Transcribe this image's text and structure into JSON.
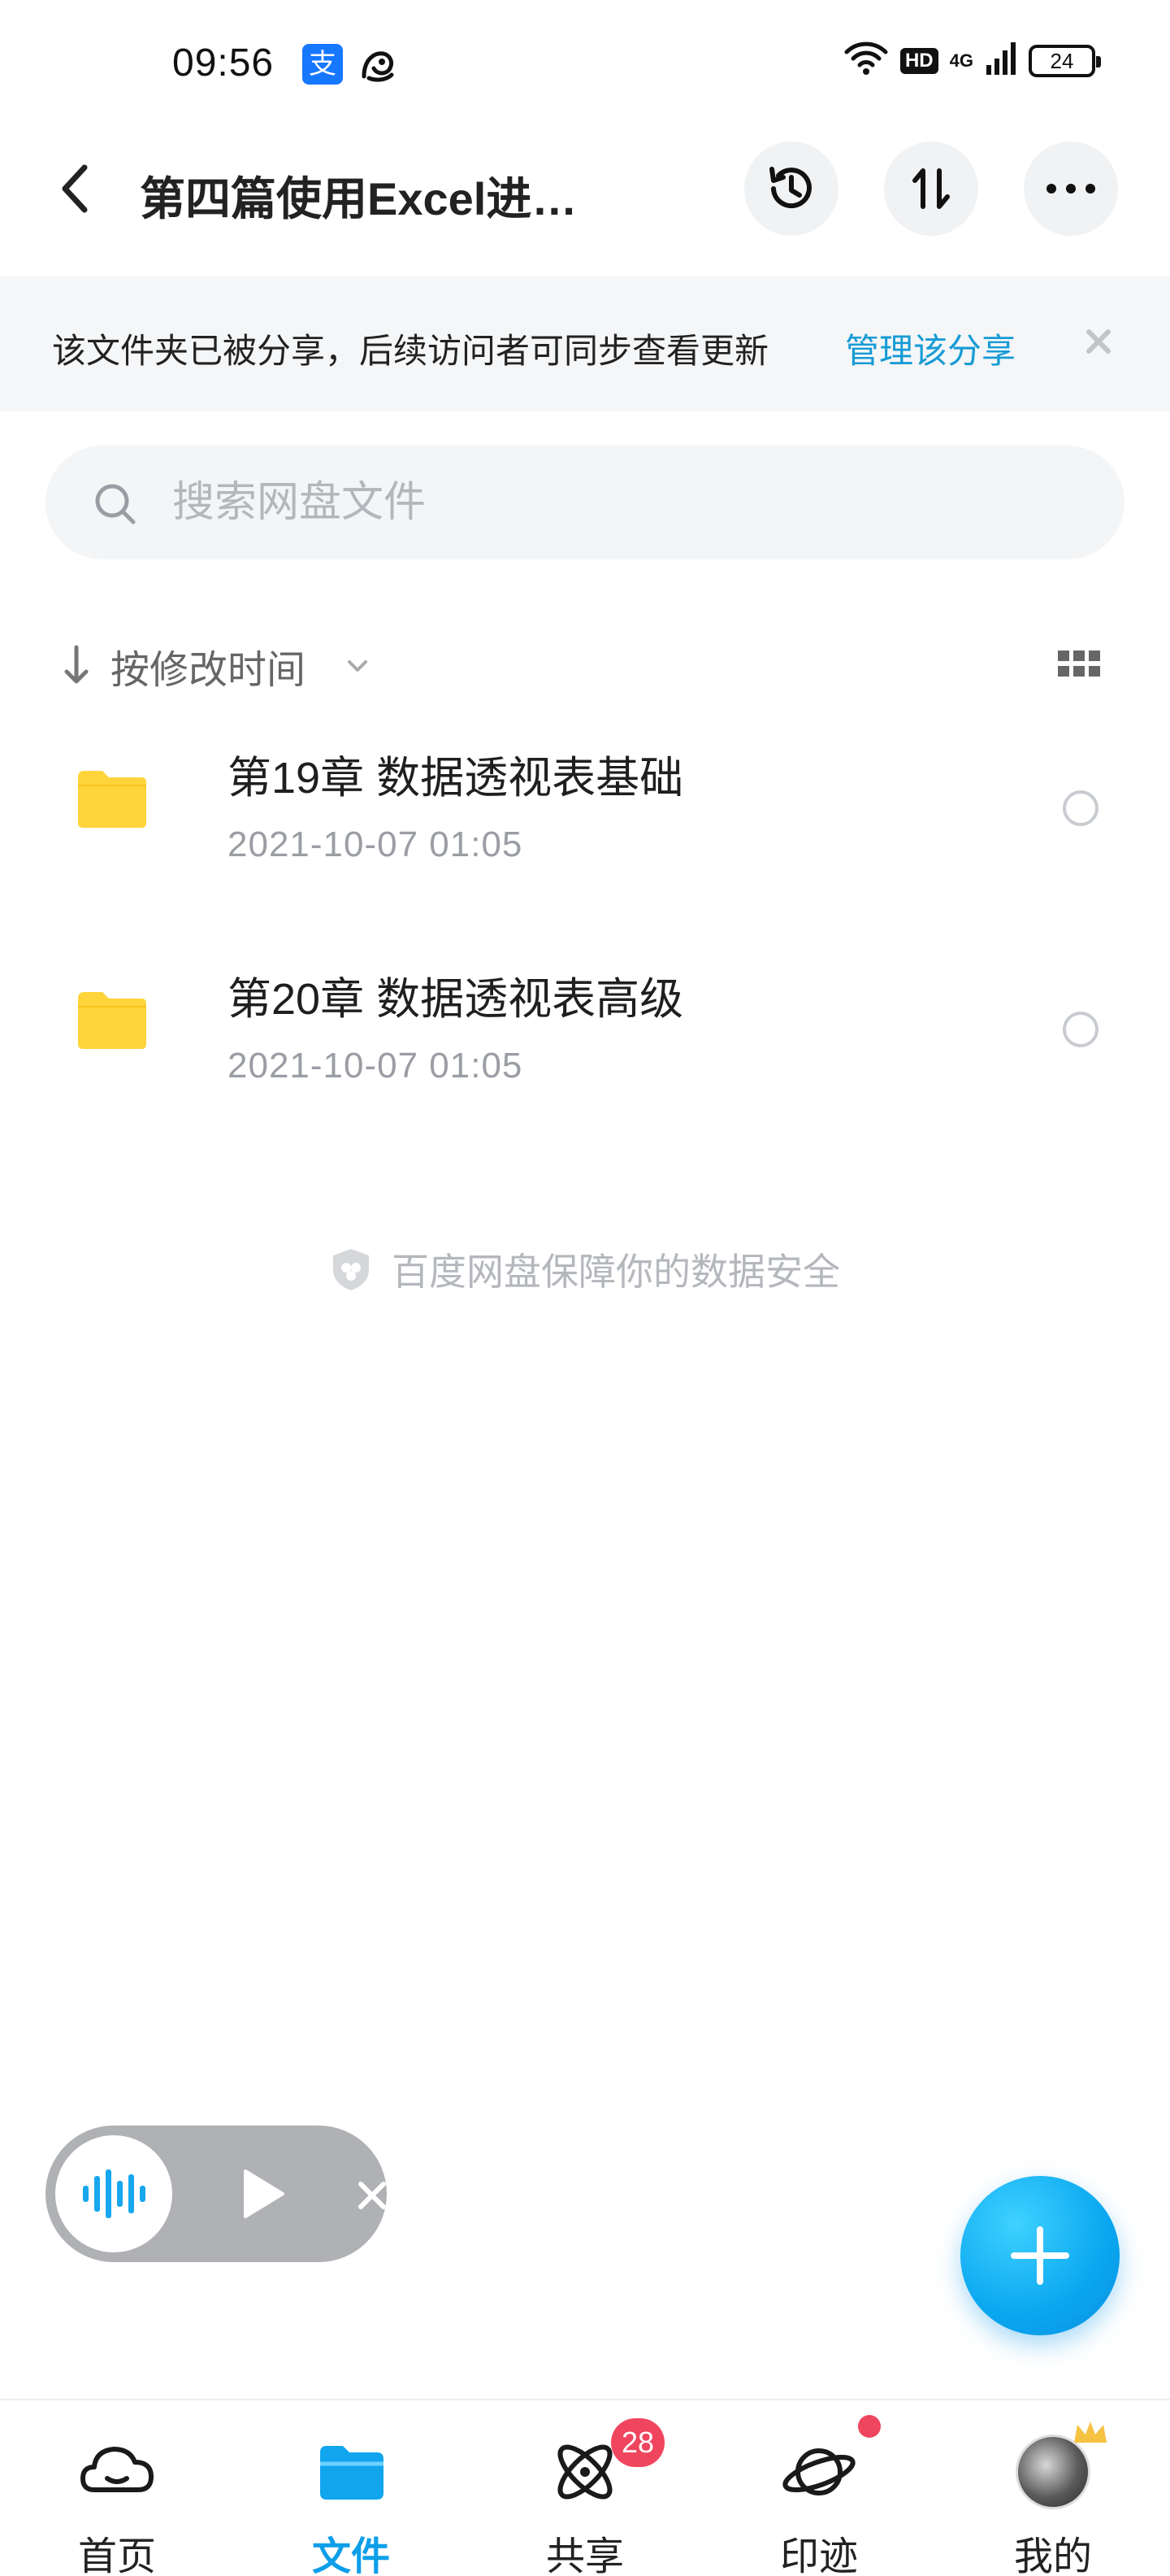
{
  "status_bar": {
    "time": "09:56",
    "alipay_glyph": "支",
    "hd_label": "HD",
    "network_label": "4G",
    "battery": "24"
  },
  "header": {
    "title": "第四篇使用Excel进…"
  },
  "share_banner": {
    "text": "该文件夹已被分享，后续访问者可同步查看更新",
    "link": "管理该分享"
  },
  "search": {
    "placeholder": "搜索网盘文件"
  },
  "sort": {
    "label": "按修改时间"
  },
  "files": [
    {
      "name": "第19章 数据透视表基础",
      "date": "2021-10-07  01:05",
      "icon": "folder-icon"
    },
    {
      "name": "第20章 数据透视表高级",
      "date": "2021-10-07  01:05",
      "icon": "folder-icon"
    }
  ],
  "security_note": "百度网盘保障你的数据安全",
  "bottom_nav": {
    "items": [
      {
        "label": "首页",
        "icon": "cloud-home-icon",
        "active": false
      },
      {
        "label": "文件",
        "icon": "folder-tab-icon",
        "active": true
      },
      {
        "label": "共享",
        "icon": "atom-share-icon",
        "active": false,
        "badge": "28"
      },
      {
        "label": "印迹",
        "icon": "planet-icon",
        "active": false,
        "dot": true
      },
      {
        "label": "我的",
        "icon": "avatar",
        "active": false
      }
    ]
  },
  "colors": {
    "accent": "#0d9ee9",
    "link": "#169bd5",
    "badge": "#f0455e",
    "folder": "#ffd43b"
  }
}
